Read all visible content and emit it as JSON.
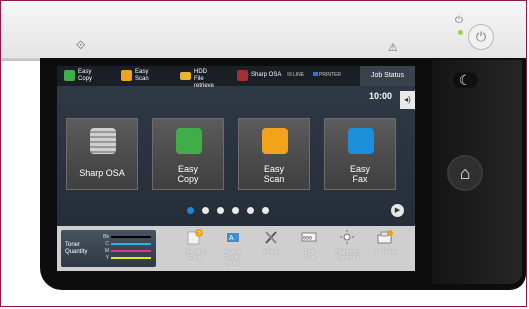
{
  "device": {
    "wifi_icon": "wifi-direct-icon",
    "warning_icon": "warning-icon",
    "power_icon": "power-icon",
    "energy_save_icon": "moon-icon",
    "home_icon": "home-icon"
  },
  "status_bar": {
    "items": [
      {
        "label": "Easy\nCopy",
        "icon": "easy-copy-icon",
        "color": "#3fae49"
      },
      {
        "label": "Easy\nScan",
        "icon": "easy-scan-icon",
        "color": "#f2a31c"
      },
      {
        "label": "HDD\nFile retrieve",
        "icon": "folder-icon",
        "color": "#e8b531"
      },
      {
        "label": "Sharp OSA",
        "icon": "sharp-osa-icon",
        "color": "#a13030"
      }
    ],
    "line_label": "LINE",
    "printer_label": "PRINTER",
    "job_status": "Job Status"
  },
  "screen": {
    "time": "10:00",
    "speaker_icon": "speaker-icon"
  },
  "cards": [
    {
      "label": "Sharp OSA",
      "icon": "sharp-osa-icon",
      "color": "#b8b8b8"
    },
    {
      "label": "Easy\nCopy",
      "icon": "easy-copy-icon",
      "color": "#3fae49"
    },
    {
      "label": "Easy\nScan",
      "icon": "easy-scan-icon",
      "color": "#f2a31c"
    },
    {
      "label": "Easy\nFax",
      "icon": "easy-fax-icon",
      "color": "#1b8fd9"
    }
  ],
  "pagination": {
    "count": 6,
    "active": 0
  },
  "toner": {
    "label": "Toner\nQuantity",
    "rows": [
      {
        "name": "Bk",
        "color": "#000000"
      },
      {
        "name": "C",
        "color": "#2bb3e6"
      },
      {
        "name": "M",
        "color": "#d23c8c"
      },
      {
        "name": "Y",
        "color": "#e8e02a"
      }
    ]
  },
  "tools": [
    {
      "label": "Operation\nGuide",
      "icon": "operation-guide-icon"
    },
    {
      "label": "Enlarge\nDisplay\nMode",
      "icon": "enlarge-display-icon"
    },
    {
      "label": "Settings",
      "icon": "settings-icon"
    },
    {
      "label": "Total\nCount",
      "icon": "total-count-icon"
    },
    {
      "label": "Brightness\nAdjustment",
      "icon": "brightness-icon"
    },
    {
      "label": "Job Status",
      "icon": "job-status-icon"
    }
  ]
}
